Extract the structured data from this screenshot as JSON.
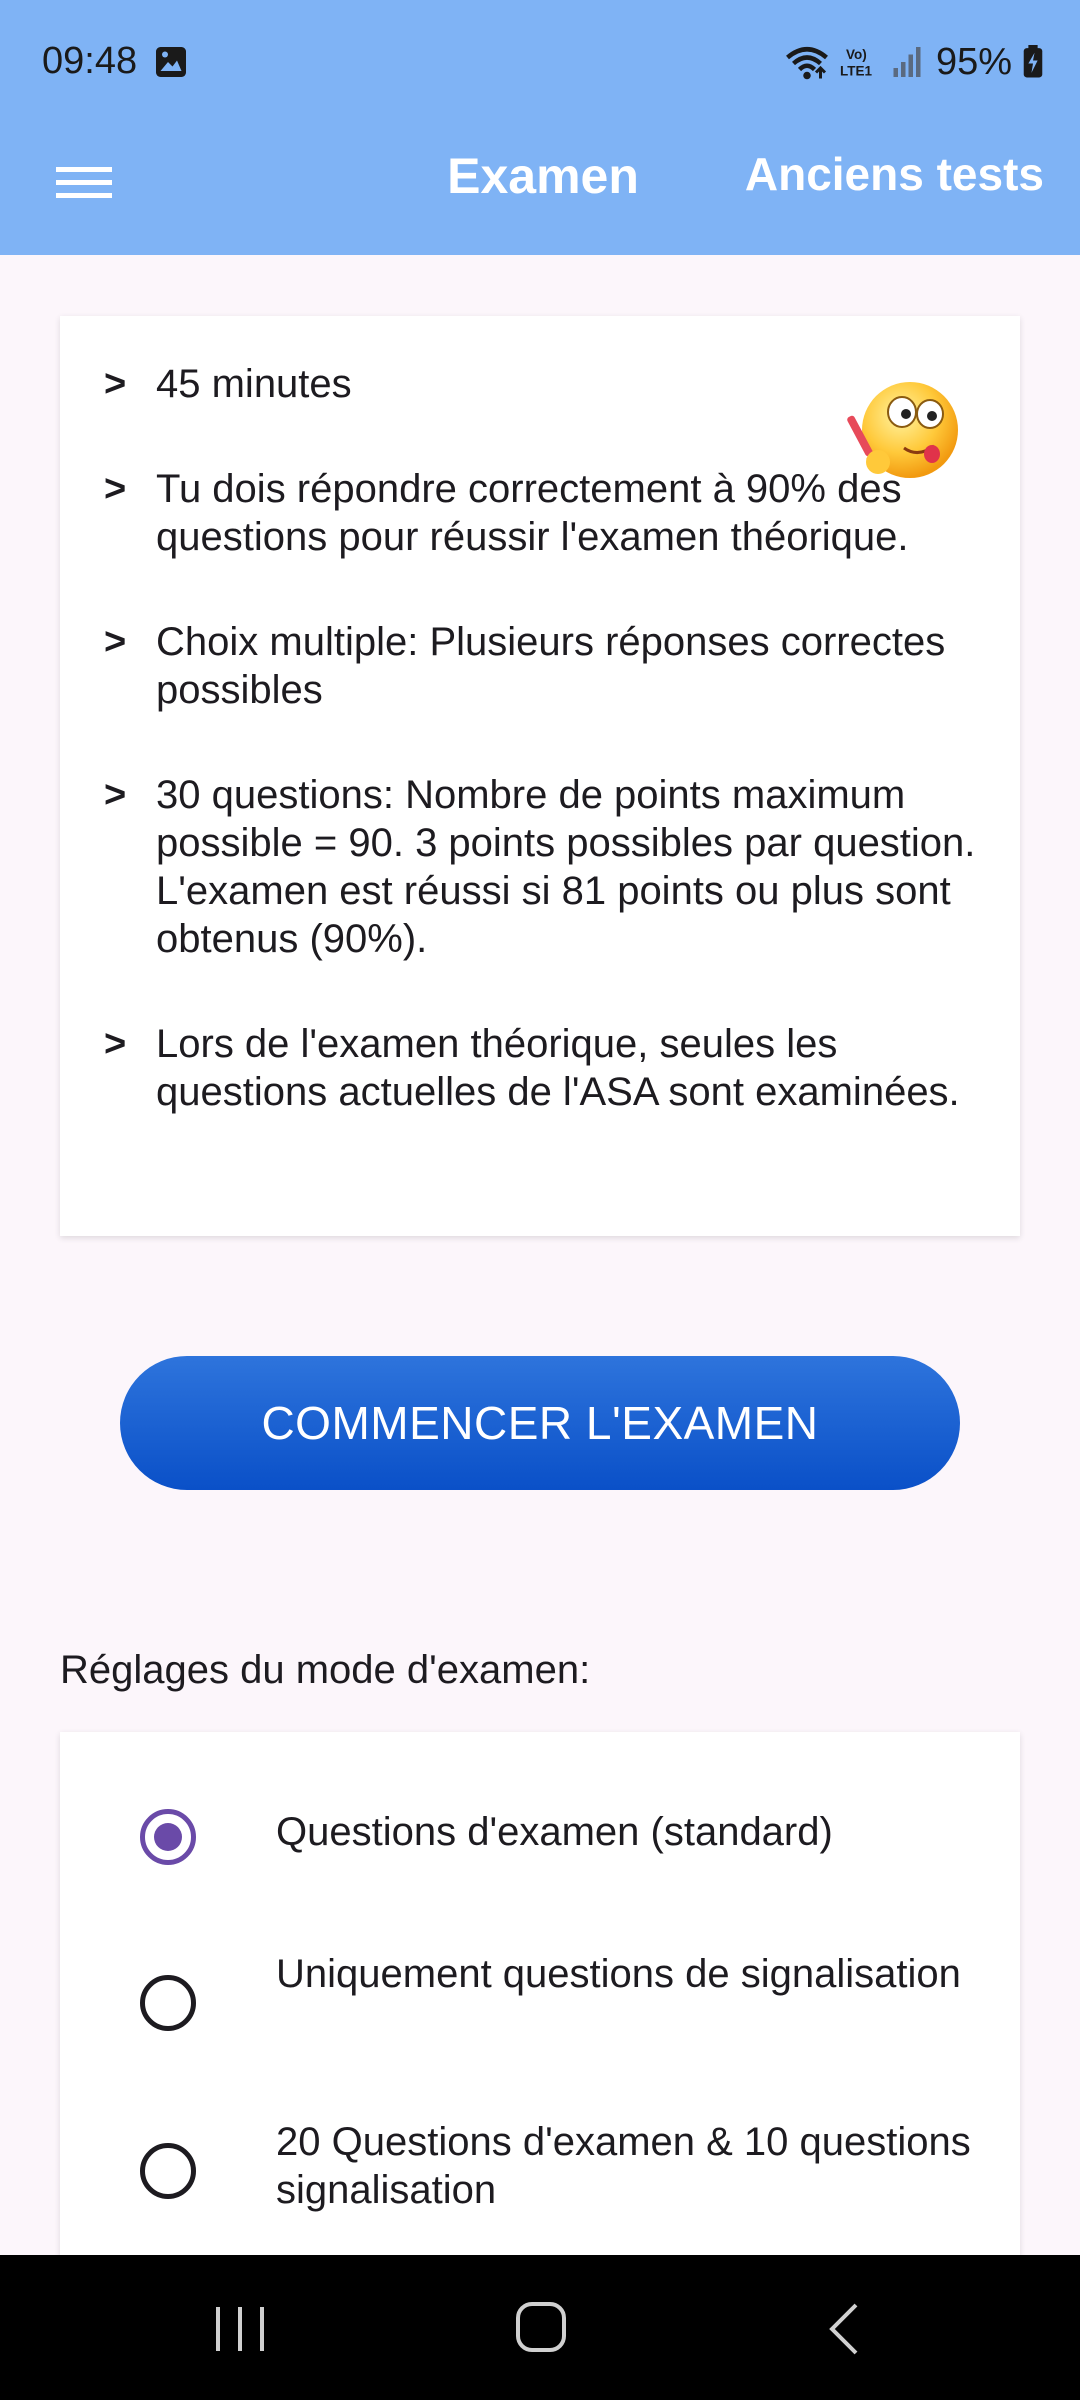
{
  "status_bar": {
    "time": "09:48",
    "battery": "95%",
    "icons": [
      "gallery-icon",
      "wifi-icon",
      "volte-icon",
      "signal-icon",
      "battery-icon"
    ]
  },
  "app_bar": {
    "title": "Examen",
    "action": "Anciens tests",
    "menu_icon": "hamburger-menu-icon"
  },
  "info": {
    "bullet": ">",
    "items": [
      "45 minutes",
      "Tu dois répondre correctement à 90% des questions pour réussir l'examen théorique.",
      "Choix multiple: Plusieurs réponses correctes possibles",
      "30 questions: Nombre de points maximum possible = 90. 3 points possibles par question. L'examen est réussi si 81 points ou plus sont obtenus (90%).",
      "Lors de l'examen théorique, seules les questions actuelles de l'ASA sont examinées."
    ]
  },
  "start_button": "COMMENCER L'EXAMEN",
  "settings": {
    "label": "Réglages du mode d'examen:",
    "options": [
      {
        "label": "Questions d'examen (standard)",
        "selected": true
      },
      {
        "label": "Uniquement questions de signalisation",
        "selected": false
      },
      {
        "label": "20 Questions d'examen & 10 questions signalisation",
        "selected": false
      }
    ]
  },
  "colors": {
    "app_bar": "#7fb3f5",
    "primary_button": "#0a50c8",
    "radio_selected": "#6a4aa8",
    "background": "#fcf6fb"
  },
  "nav_bar": {
    "icons": [
      "recents-icon",
      "home-icon",
      "back-icon"
    ]
  }
}
